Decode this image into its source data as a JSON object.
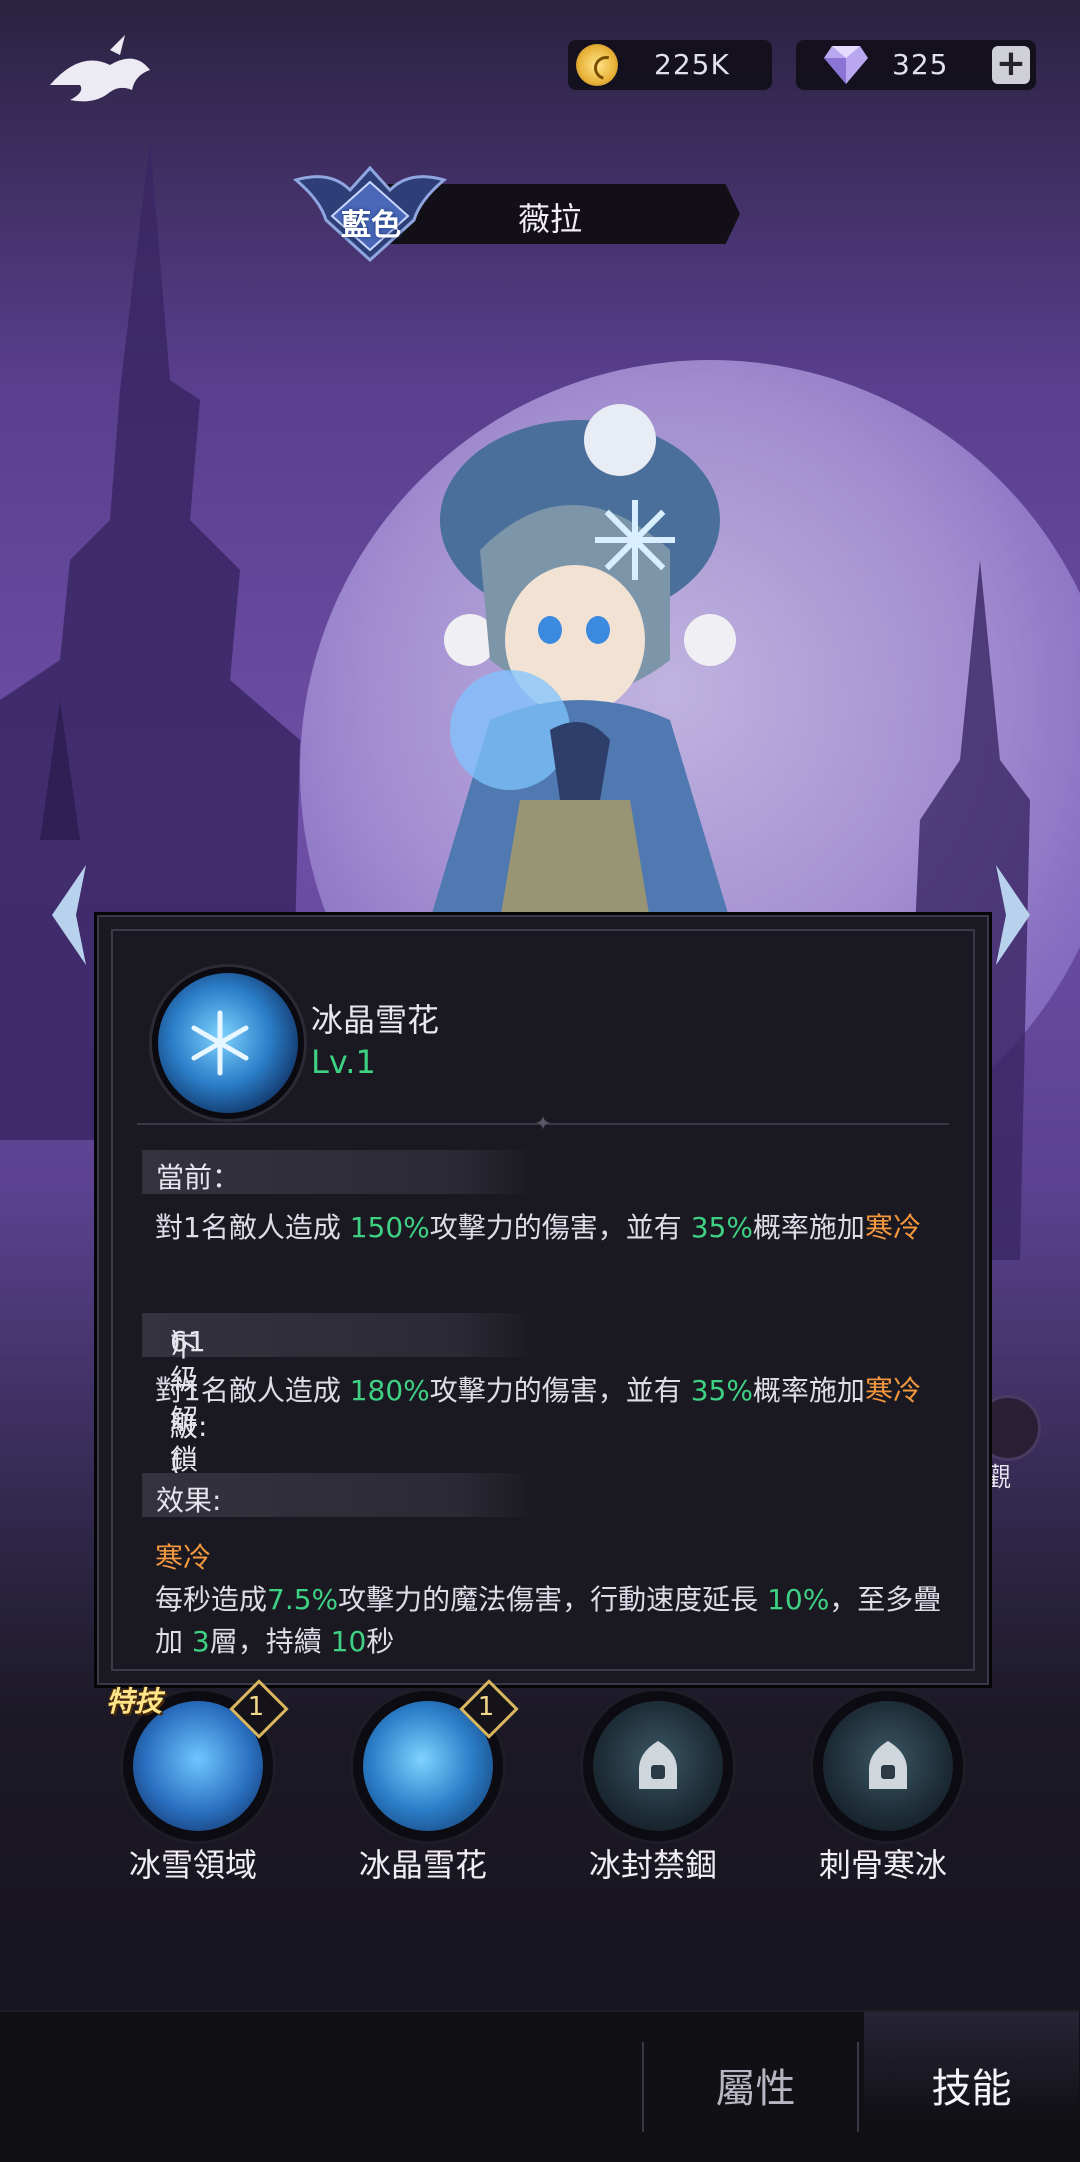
{
  "header": {
    "gold_value": "225K",
    "gem_value": "325",
    "add_label": "+"
  },
  "hero": {
    "rank": "藍色",
    "name": "薇拉"
  },
  "skill_detail": {
    "title": "冰晶雪花",
    "level": "Lv.1",
    "current_heading": "當前：",
    "current_desc": {
      "p1": "對1名敵人造成 ",
      "v1": "150%",
      "p2": "攻擊力的傷害，並有 ",
      "v2": "35%",
      "p3": "概率施加",
      "status": "寒冷"
    },
    "next_heading": "下一級: (",
    "next_lock": "61級解鎖",
    "next_heading_end": ")",
    "next_desc": {
      "p1": "對1名敵人造成 ",
      "v1": "180%",
      "p2": "攻擊力的傷害，並有 ",
      "v2": "35%",
      "p3": "概率施加",
      "status": "寒冷"
    },
    "effect_heading": "效果:",
    "effect_name": "寒冷",
    "effect_desc": {
      "p1": "每秒造成",
      "v1": "7.5%",
      "p2": "攻擊力的魔法傷害，行動速度延長 ",
      "v2": "10%",
      "p3": "，至多疊加 ",
      "v3": "3",
      "p4": "層，持續 ",
      "v4": "10",
      "p5": "秒"
    }
  },
  "skills": [
    {
      "label": "冰雪領域",
      "level": "1",
      "tag": "特技",
      "locked": false
    },
    {
      "label": "冰晶雪花",
      "level": "1",
      "tag": "",
      "locked": false
    },
    {
      "label": "冰封禁錮",
      "level": "",
      "tag": "",
      "locked": true
    },
    {
      "label": "刺骨寒冰",
      "level": "",
      "tag": "",
      "locked": true
    }
  ],
  "side_button": {
    "label": "觀"
  },
  "tabs": [
    {
      "label": "屬性",
      "active": false
    },
    {
      "label": "技能",
      "active": true
    }
  ],
  "colors": {
    "accent_green": "#3fd183",
    "status_orange": "#f2973e",
    "lock_red": "#ff5a4a"
  }
}
